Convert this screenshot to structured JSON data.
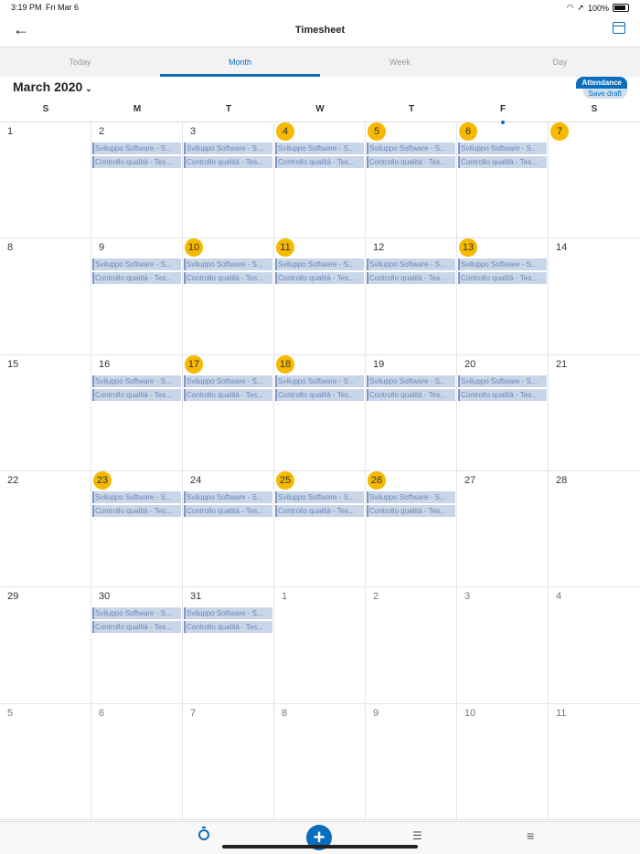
{
  "status_bar": {
    "time": "3:19 PM",
    "date": "Fri Mar 6",
    "battery": "100%"
  },
  "nav": {
    "title": "Timesheet"
  },
  "tabs": [
    "Today",
    "Month",
    "Week",
    "Day"
  ],
  "active_tab": "Month",
  "month_label": "March 2020",
  "badges": {
    "attendance": "Attendance",
    "save_draft": "Save draft"
  },
  "weekdays": [
    "S",
    "M",
    "T",
    "W",
    "T",
    "F",
    "S"
  ],
  "entry_labels": {
    "e1": "Sviluppo Software - S...",
    "e2": "Controllo qualità - Tes..."
  },
  "weeks": [
    [
      {
        "day": "1"
      },
      {
        "day": "2",
        "entries": true
      },
      {
        "day": "3",
        "entries": true
      },
      {
        "day": "4",
        "highlight": true,
        "entries": true
      },
      {
        "day": "5",
        "highlight": true,
        "entries": true
      },
      {
        "day": "6",
        "highlight": true,
        "entries": true
      },
      {
        "day": "7",
        "highlight": true
      }
    ],
    [
      {
        "day": "8"
      },
      {
        "day": "9",
        "entries": true
      },
      {
        "day": "10",
        "highlight": true,
        "entries": true
      },
      {
        "day": "11",
        "highlight": true,
        "entries": true
      },
      {
        "day": "12",
        "entries": true
      },
      {
        "day": "13",
        "highlight": true,
        "entries": true
      },
      {
        "day": "14"
      }
    ],
    [
      {
        "day": "15"
      },
      {
        "day": "16",
        "entries": true
      },
      {
        "day": "17",
        "highlight": true,
        "entries": true
      },
      {
        "day": "18",
        "highlight": true,
        "entries": true
      },
      {
        "day": "19",
        "entries": true
      },
      {
        "day": "20",
        "entries": true
      },
      {
        "day": "21"
      }
    ],
    [
      {
        "day": "22"
      },
      {
        "day": "23",
        "highlight": true,
        "entries": true
      },
      {
        "day": "24",
        "entries": true
      },
      {
        "day": "25",
        "highlight": true,
        "entries": true
      },
      {
        "day": "26",
        "highlight": true,
        "entries": true
      },
      {
        "day": "27"
      },
      {
        "day": "28"
      }
    ],
    [
      {
        "day": "29"
      },
      {
        "day": "30",
        "entries": true
      },
      {
        "day": "31",
        "entries": true
      },
      {
        "day": "1",
        "other": true
      },
      {
        "day": "2",
        "other": true
      },
      {
        "day": "3",
        "other": true
      },
      {
        "day": "4",
        "other": true
      }
    ],
    [
      {
        "day": "5",
        "other": true
      },
      {
        "day": "6",
        "other": true
      },
      {
        "day": "7",
        "other": true
      },
      {
        "day": "8",
        "other": true
      },
      {
        "day": "9",
        "other": true
      },
      {
        "day": "10",
        "other": true
      },
      {
        "day": "11",
        "other": true
      }
    ]
  ],
  "bottom_bar": {
    "add_symbol": "+",
    "list_symbol": "☰",
    "menu_symbol": "≡"
  },
  "colors": {
    "accent": "#0a6ebd",
    "highlight": "#f6b900",
    "entry_bg": "#c9d6e8"
  }
}
